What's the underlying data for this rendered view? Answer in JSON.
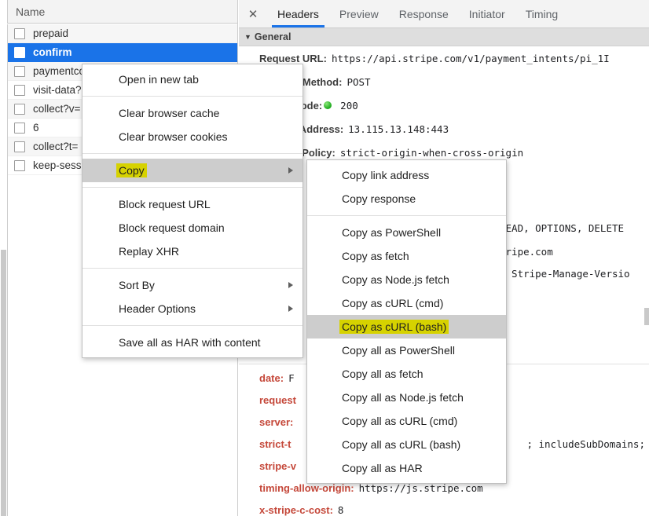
{
  "left_panel": {
    "column_header": "Name",
    "rows": [
      {
        "name": "prepaid",
        "selected": false
      },
      {
        "name": "confirm",
        "selected": true
      },
      {
        "name": "paymentco",
        "selected": false
      },
      {
        "name": "visit-data?",
        "selected": false
      },
      {
        "name": "collect?v=",
        "selected": false
      },
      {
        "name": "6",
        "selected": false
      },
      {
        "name": "collect?t=",
        "selected": false
      },
      {
        "name": "keep-sessi",
        "selected": false
      }
    ]
  },
  "details": {
    "close_label": "✕",
    "tabs": [
      {
        "label": "Headers",
        "active": true
      },
      {
        "label": "Preview",
        "active": false
      },
      {
        "label": "Response",
        "active": false
      },
      {
        "label": "Initiator",
        "active": false
      },
      {
        "label": "Timing",
        "active": false
      }
    ],
    "general": {
      "section_label": "General",
      "triangle": "▼",
      "rows": [
        {
          "key": "Request URL:",
          "value": "https://api.stripe.com/v1/payment_intents/pi_1I"
        },
        {
          "key": "Request Method:",
          "value": "POST"
        },
        {
          "key": "Status Code:",
          "value": "200",
          "has_status_dot": true
        },
        {
          "key": "Remote Address:",
          "value": "13.115.13.148:443"
        },
        {
          "key": "Referrer Policy:",
          "value": "strict-origin-when-cross-origin"
        }
      ]
    },
    "hidden_values": [
      "HEAD, OPTIONS, DELETE",
      "tripe.com",
      ", Stripe-Manage-Versio"
    ],
    "response_headers": [
      {
        "key": "date:",
        "value": "F"
      },
      {
        "key": "request",
        "value": ""
      },
      {
        "key": "server:",
        "value": ""
      },
      {
        "key": "strict-t",
        "value": "; includeSubDomains; p"
      },
      {
        "key": "stripe-v",
        "value": ""
      },
      {
        "key": "timing-allow-origin:",
        "value": "https://js.stripe.com"
      },
      {
        "key": "x-stripe-c-cost:",
        "value": "8"
      }
    ]
  },
  "context_menu": {
    "items": [
      {
        "label": "Open in new tab",
        "type": "item"
      },
      {
        "type": "separator"
      },
      {
        "label": "Clear browser cache",
        "type": "item"
      },
      {
        "label": "Clear browser cookies",
        "type": "item"
      },
      {
        "type": "separator"
      },
      {
        "label": "Copy",
        "type": "item",
        "hover": true,
        "submenu": true,
        "highlight": true
      },
      {
        "type": "separator"
      },
      {
        "label": "Block request URL",
        "type": "item"
      },
      {
        "label": "Block request domain",
        "type": "item"
      },
      {
        "label": "Replay XHR",
        "type": "item"
      },
      {
        "type": "separator"
      },
      {
        "label": "Sort By",
        "type": "item",
        "submenu": true
      },
      {
        "label": "Header Options",
        "type": "item",
        "submenu": true
      },
      {
        "type": "separator"
      },
      {
        "label": "Save all as HAR with content",
        "type": "item"
      }
    ]
  },
  "copy_submenu": {
    "items": [
      {
        "label": "Copy link address",
        "type": "item"
      },
      {
        "label": "Copy response",
        "type": "item"
      },
      {
        "type": "separator"
      },
      {
        "label": "Copy as PowerShell",
        "type": "item"
      },
      {
        "label": "Copy as fetch",
        "type": "item"
      },
      {
        "label": "Copy as Node.js fetch",
        "type": "item"
      },
      {
        "label": "Copy as cURL (cmd)",
        "type": "item"
      },
      {
        "label": "Copy as cURL (bash)",
        "type": "item",
        "hover": true,
        "highlight": true
      },
      {
        "label": "Copy all as PowerShell",
        "type": "item"
      },
      {
        "label": "Copy all as fetch",
        "type": "item"
      },
      {
        "label": "Copy all as Node.js fetch",
        "type": "item"
      },
      {
        "label": "Copy all as cURL (cmd)",
        "type": "item"
      },
      {
        "label": "Copy all as cURL (bash)",
        "type": "item"
      },
      {
        "label": "Copy all as HAR",
        "type": "item"
      }
    ]
  },
  "colors": {
    "selection_blue": "#1a73e8",
    "highlight_yellow": "#d6d200",
    "menu_hover_gray": "#cdcdcd",
    "status_green": "#1aa81a"
  }
}
